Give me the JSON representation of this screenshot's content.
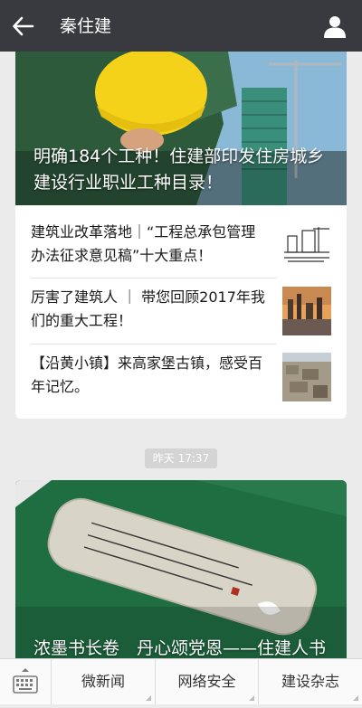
{
  "header": {
    "title": "秦住建",
    "back_icon": "arrow-left-icon",
    "profile_icon": "person-icon"
  },
  "card1": {
    "hero_title": "明确184个工种！住建部印发住房城乡建设行业职业工种目录！",
    "items": [
      {
        "title": "建筑业改革落地｜“工程总承包管理办法征求意见稿”十大重点！",
        "thumb": "construction-line-drawing"
      },
      {
        "title": "厉害了建筑人 ｜ 带您回顾2017年我们的重大工程！",
        "thumb": "city-skyline-sunset"
      },
      {
        "title": "【沿黄小镇】来高家堡古镇，感受百年记忆。",
        "thumb": "old-town-aerial"
      }
    ]
  },
  "timestamp": "昨天 17:37",
  "card2": {
    "hero_title": "浓墨书长卷　丹心颂党恩——住建人书法作品讴歌新时代"
  },
  "bottom_menu": {
    "keyboard_icon": "keyboard-icon",
    "items": [
      "微新闻",
      "网络安全",
      "建设杂志"
    ]
  },
  "colors": {
    "topbar": "#393a3f",
    "background": "#ebebeb",
    "card": "#ffffff"
  }
}
